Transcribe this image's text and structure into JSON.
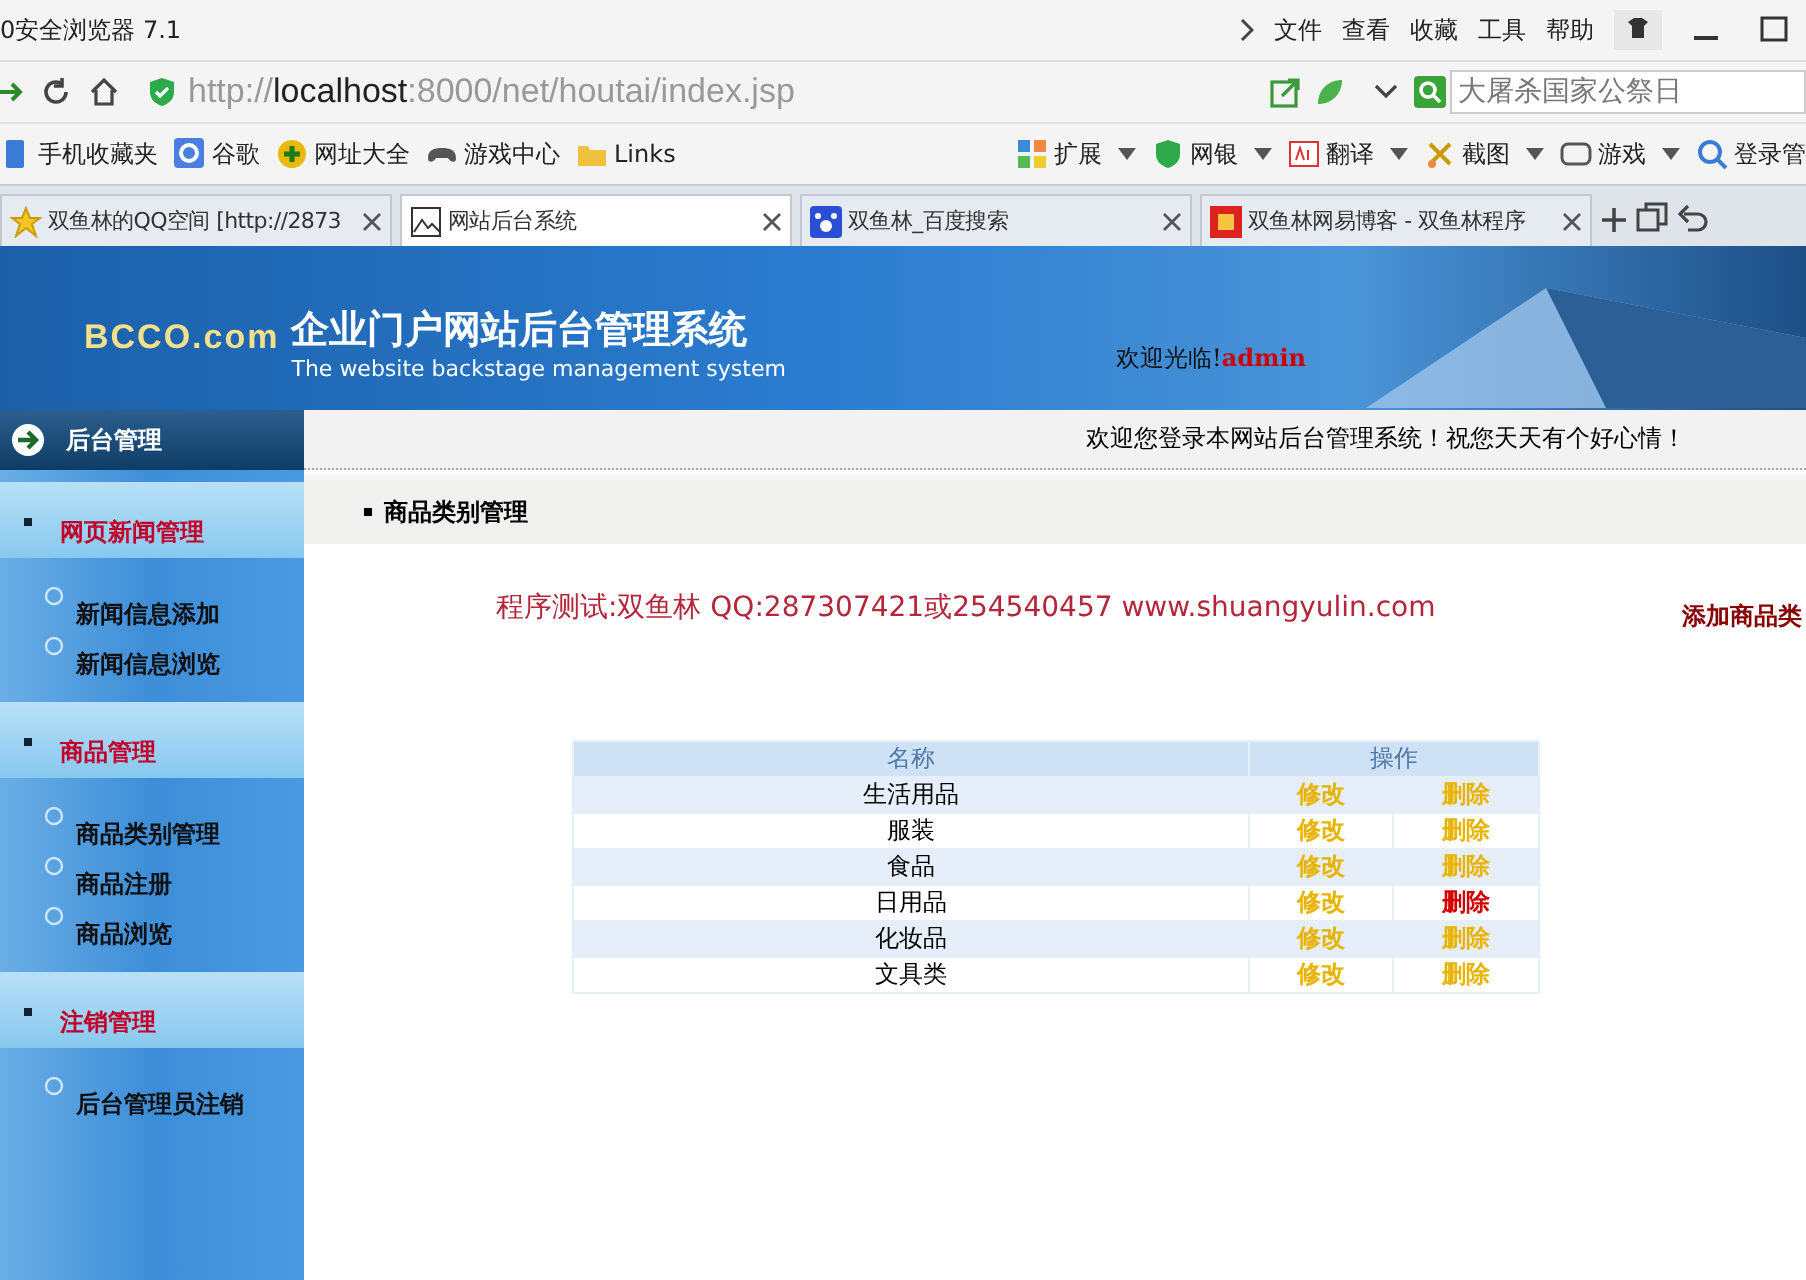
{
  "window": {
    "title": "0安全浏览器 7.1",
    "menu": [
      "文件",
      "查看",
      "收藏",
      "工具",
      "帮助"
    ]
  },
  "address_bar": {
    "url_prefix": "http://",
    "url_host": "localhost",
    "url_rest": ":8000/net/houtai/index.jsp",
    "search_placeholder": "大屠杀国家公祭日"
  },
  "bookmarks": {
    "left": [
      "手机收藏夹",
      "谷歌",
      "网址大全",
      "游戏中心",
      "Links"
    ],
    "right": [
      "扩展",
      "网银",
      "翻译",
      "截图",
      "游戏",
      "登录管"
    ]
  },
  "tabs": [
    {
      "label": "双鱼林的QQ空间 [http://2873",
      "selected": false
    },
    {
      "label": "网站后台系统",
      "selected": true
    },
    {
      "label": "双鱼林_百度搜索",
      "selected": false
    },
    {
      "label": "双鱼林网易博客 - 双鱼林程序",
      "selected": false
    }
  ],
  "banner": {
    "logo": "BCCO.com",
    "title": "企业门户网站后台管理系统",
    "subtitle": "The website backstage management system",
    "welcome": "欢迎光临!",
    "user": "admin"
  },
  "nav": {
    "label": "后台管理",
    "message": "欢迎您登录本网站后台管理系统！祝您天天有个好心情！"
  },
  "sidebar": {
    "groups": [
      {
        "label": "网页新闻管理",
        "children": [
          "新闻信息添加",
          "新闻信息浏览"
        ]
      },
      {
        "label": "商品管理",
        "children": [
          "商品类别管理",
          "商品注册",
          "商品浏览"
        ]
      },
      {
        "label": "注销管理",
        "children": [
          "后台管理员注销"
        ]
      }
    ]
  },
  "content": {
    "breadcrumb": "商品类别管理",
    "notice": "程序测试:双鱼林 QQ:287307421或254540457 www.shuangyulin.com",
    "add_link": "添加商品类",
    "table": {
      "columns": [
        "名称",
        "操作"
      ],
      "rows": [
        {
          "name": "生活用品",
          "edit": "修改",
          "delete": "删除",
          "highlighted": false
        },
        {
          "name": "服装",
          "edit": "修改",
          "delete": "删除",
          "highlighted": false
        },
        {
          "name": "食品",
          "edit": "修改",
          "delete": "删除",
          "highlighted": false
        },
        {
          "name": "日用品",
          "edit": "修改",
          "delete": "删除",
          "highlighted": true
        },
        {
          "name": "化妆品",
          "edit": "修改",
          "delete": "删除",
          "highlighted": false
        },
        {
          "name": "文具类",
          "edit": "修改",
          "delete": "删除",
          "highlighted": false
        }
      ]
    }
  }
}
